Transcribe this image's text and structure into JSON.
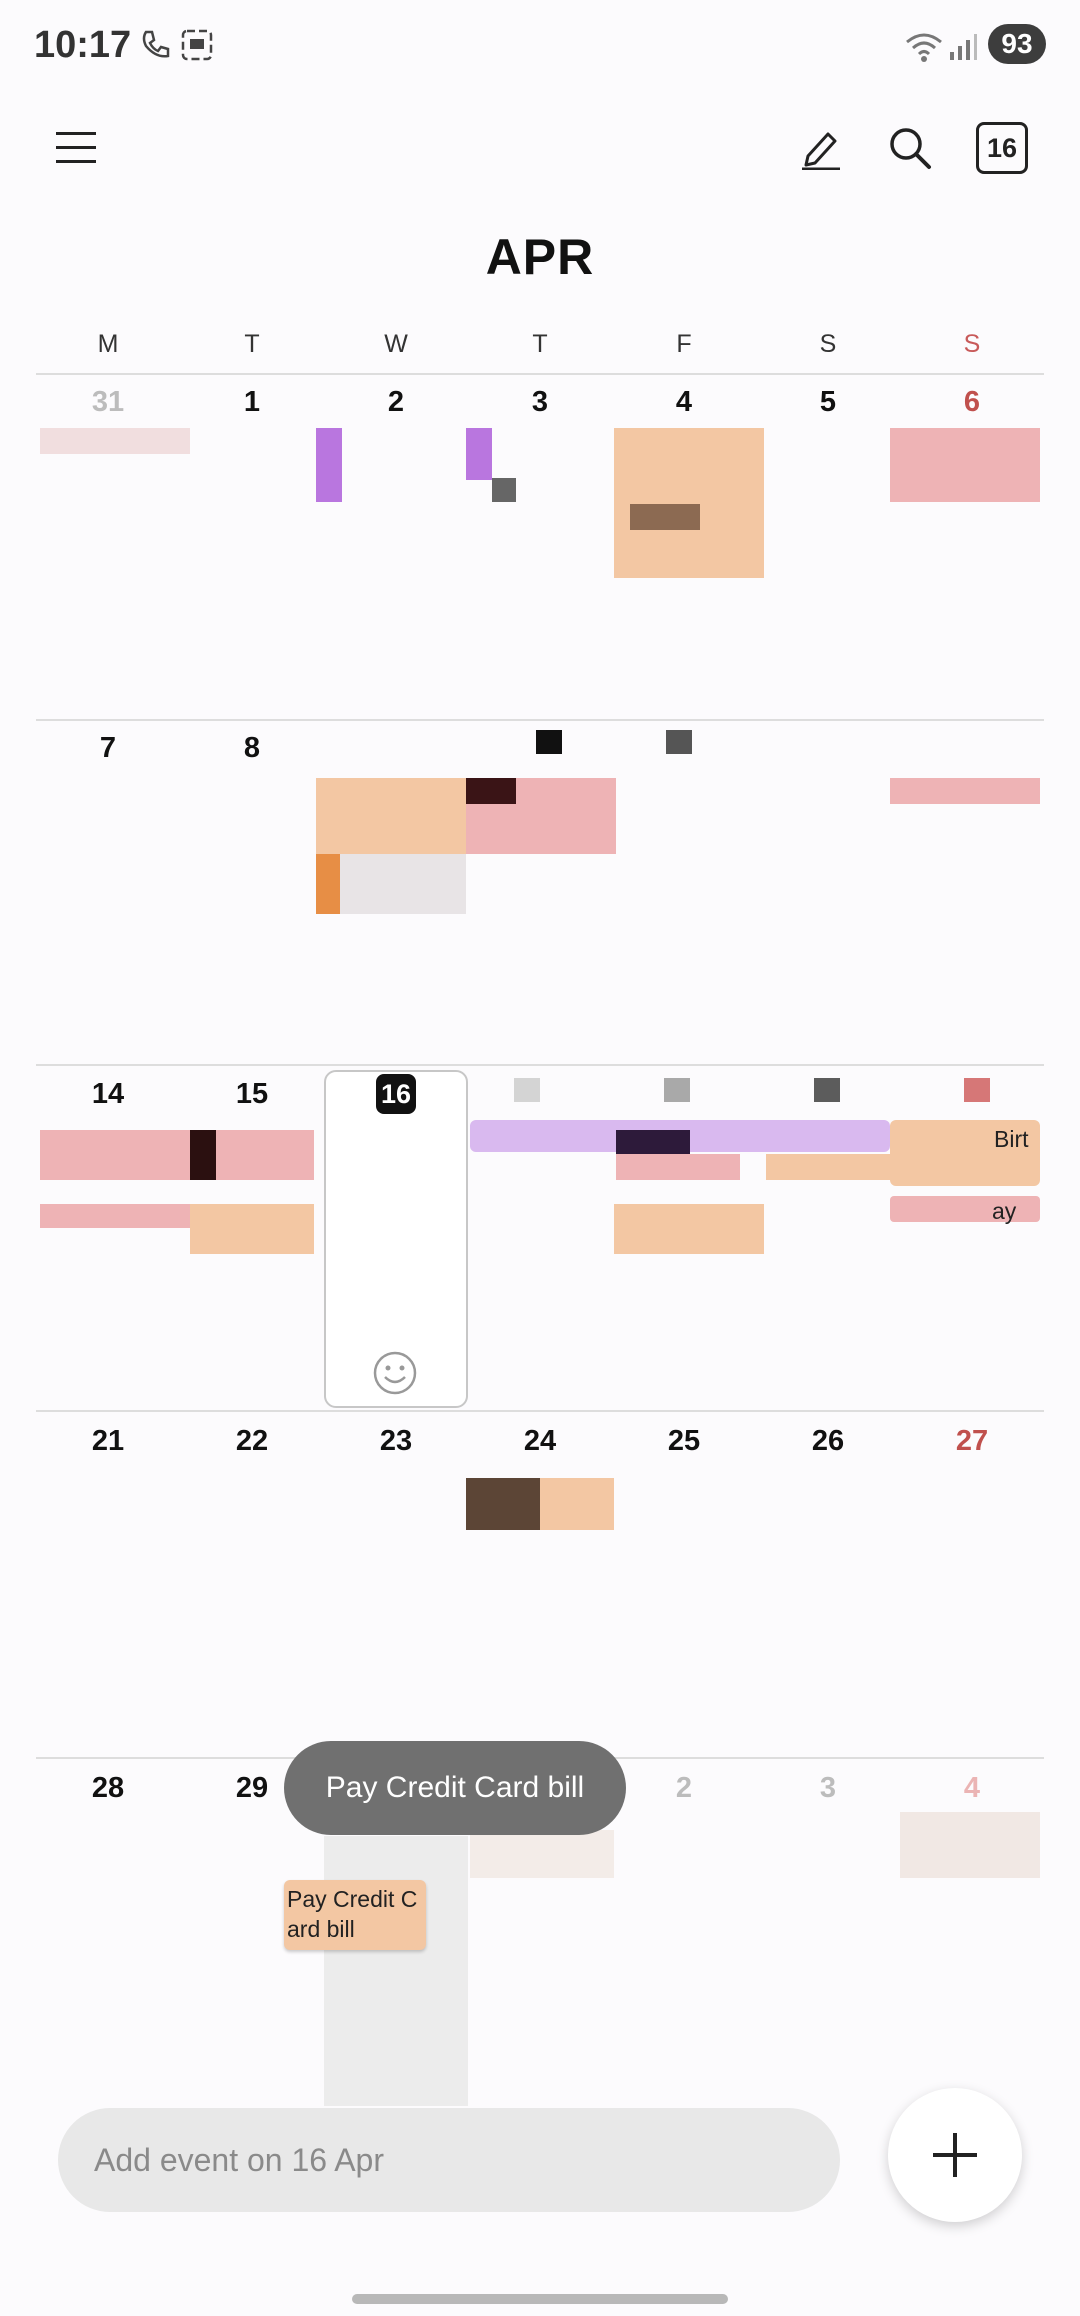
{
  "status_bar": {
    "time": "10:17",
    "battery": "93"
  },
  "header": {
    "today_button": "16"
  },
  "month": "APR",
  "weekdays": [
    "M",
    "T",
    "W",
    "T",
    "F",
    "S",
    "S"
  ],
  "weeks": [
    [
      "31",
      "1",
      "2",
      "3",
      "4",
      "5",
      "6"
    ],
    [
      "7",
      "8",
      "",
      "",
      "",
      "",
      ""
    ],
    [
      "14",
      "15",
      "16",
      "",
      "",
      "",
      ""
    ],
    [
      "21",
      "22",
      "23",
      "24",
      "25",
      "26",
      "27"
    ],
    [
      "28",
      "29",
      "",
      "",
      "2",
      "3",
      "4"
    ]
  ],
  "events": {
    "birthday_short": "Birt",
    "pay_short": "ay",
    "pay_credit_card": "Pay Credit C ard bill"
  },
  "toast": "Pay Credit Card bill",
  "add_event_placeholder": "Add event on 16 Apr",
  "colors": {
    "accent_peach": "#f3c7a3",
    "accent_pink": "#eeb3b5",
    "sunday_red": "#c0504d"
  }
}
